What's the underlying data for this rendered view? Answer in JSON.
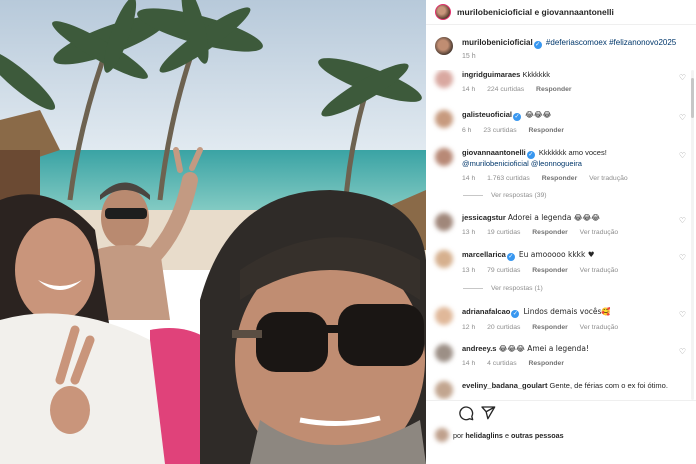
{
  "header": {
    "names": "murilobenicioficial e giovannaantonelli"
  },
  "caption": {
    "username": "murilobenicioficial",
    "hashtags": "#deferiascomoex #felizanonovo2025",
    "time": "15 h"
  },
  "comments": [
    {
      "username": "ingridguimaraes",
      "verified": false,
      "text": "Kkkkkkk",
      "time": "14 h",
      "likes": "224 curtidas",
      "reply": "Responder",
      "translate": ""
    },
    {
      "username": "galisteuoficial",
      "verified": true,
      "text": "😂😂😂",
      "time": "6 h",
      "likes": "23 curtidas",
      "reply": "Responder",
      "translate": ""
    },
    {
      "username": "giovannaantonelli",
      "verified": true,
      "text": "Kkkkkkk amo voces!",
      "mentions": "@murilobenicioficial @leonnogueira",
      "time": "14 h",
      "likes": "1.763 curtidas",
      "reply": "Responder",
      "translate": "Ver tradução",
      "replies": "Ver respostas (39)"
    },
    {
      "username": "jessicagstur",
      "verified": false,
      "text": "Adorei a legenda 😂😂😂",
      "time": "13 h",
      "likes": "19 curtidas",
      "reply": "Responder",
      "translate": "Ver tradução"
    },
    {
      "username": "marcellarica",
      "verified": true,
      "text": "Eu amooooo kkkk ♥",
      "time": "13 h",
      "likes": "79 curtidas",
      "reply": "Responder",
      "translate": "Ver tradução",
      "replies": "Ver respostas (1)"
    },
    {
      "username": "adrianafalcao",
      "verified": true,
      "text": "Lindos demais vocês🥰",
      "time": "12 h",
      "likes": "20 curtidas",
      "reply": "Responder",
      "translate": "Ver tradução"
    },
    {
      "username": "andreey.s",
      "verified": false,
      "text": "😂😂😂 Amei a legenda!",
      "time": "14 h",
      "likes": "4 curtidas",
      "reply": "Responder",
      "translate": ""
    },
    {
      "username": "eveliny_badana_goulart",
      "verified": false,
      "text": "Gente, de férias com o ex foi ótimo.",
      "time": "",
      "likes": "",
      "reply": "",
      "translate": ""
    }
  ],
  "likes": {
    "prefix": "por",
    "user": "helidaglins",
    "connector": "e",
    "others": "outras pessoas"
  },
  "colors": {
    "accent": "#3897f0",
    "heart": "#ed4956",
    "link": "#00376b",
    "secondary": "#8e8e8e"
  },
  "icons": [
    "comment-icon",
    "share-icon",
    "heart-icon",
    "verified-icon"
  ]
}
